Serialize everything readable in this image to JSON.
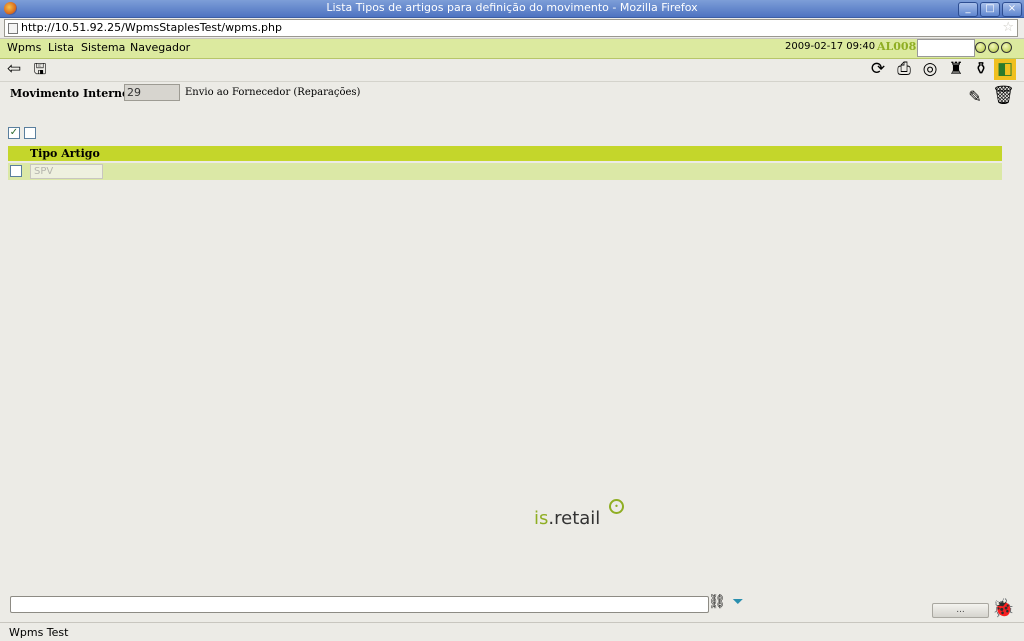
{
  "window": {
    "title": "Lista Tipos de artigos para definição do movimento - Mozilla Firefox",
    "buttons": [
      "_",
      "□",
      "×"
    ]
  },
  "browser": {
    "url": "http://10.51.92.25/WpmsStaplesTest/wpms.php",
    "status": "Wpms Test"
  },
  "menu": {
    "items": [
      "Wpms",
      "Lista",
      "Sistema",
      "Navegador"
    ],
    "datetime": "2009-02-17 09:40",
    "user": "AL008"
  },
  "toolbar": {
    "left_icons": [
      "back-arrow-icon",
      "save-icon"
    ],
    "right_icons": [
      "refresh-icon",
      "print-icon",
      "lifebuoy-icon",
      "stamp-icon",
      "pot-icon",
      "exit-door-icon"
    ]
  },
  "form": {
    "label": "Movimento Interno:",
    "value": "29",
    "description": "Envio ao Fornecedor (Reparações)"
  },
  "table": {
    "header": "Tipo Artigo",
    "rows": [
      {
        "value": "SPV",
        "checked": false
      }
    ]
  },
  "select_all": {
    "checked": true
  },
  "logo": {
    "brand_prefix": "is",
    "brand_name": ".retail"
  },
  "footer": {
    "pager_label": "..."
  },
  "colors": {
    "accent": "#c4d62b",
    "menu_bg": "#dcea9f",
    "row_bg": "#dbe8a6",
    "brand": "#8fae23"
  }
}
